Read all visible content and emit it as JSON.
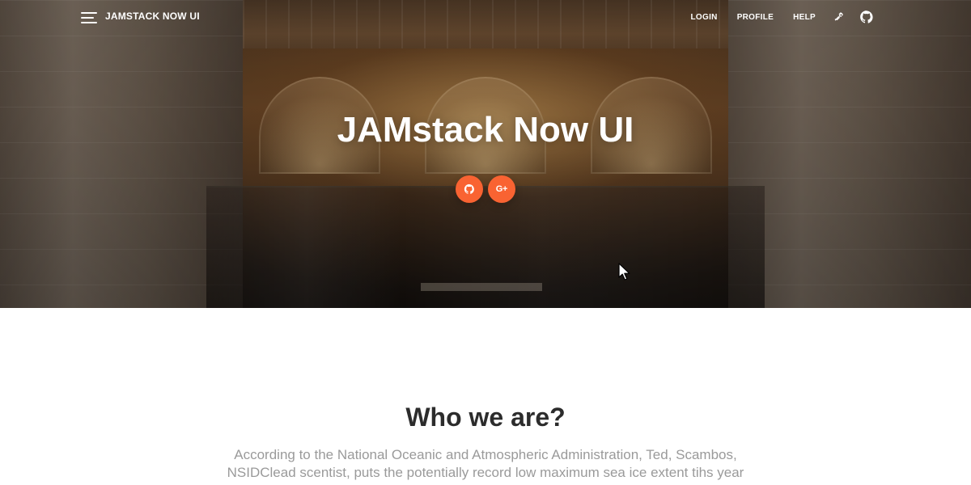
{
  "navbar": {
    "brand": "JAMSTACK NOW UI",
    "links": [
      {
        "label": "LOGIN"
      },
      {
        "label": "PROFILE"
      },
      {
        "label": "HELP"
      }
    ],
    "icons": [
      {
        "name": "rocket-icon"
      },
      {
        "name": "github-icon"
      }
    ]
  },
  "hero": {
    "title": "JAMstack Now UI",
    "social_buttons": [
      {
        "name": "github-icon"
      },
      {
        "name": "google-plus-icon",
        "text": "G+"
      }
    ]
  },
  "about": {
    "title": "Who we are?",
    "text": "According to the National Oceanic and Atmospheric Administration, Ted, Scambos, NSIDClead scentist, puts the potentially record low maximum sea ice extent tihs year down to low ice extent in the Pacific and a late drop in ice extent"
  },
  "colors": {
    "accent": "#f96332",
    "heading": "#2c2c2c",
    "body_text": "#9a9a9a",
    "navbar_text": "#ffffff"
  }
}
